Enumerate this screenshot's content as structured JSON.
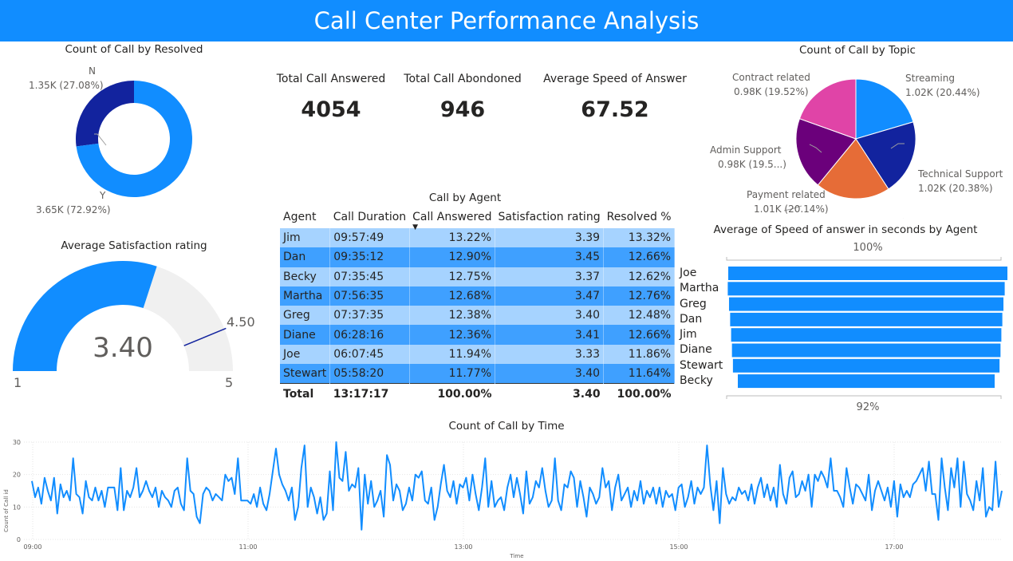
{
  "banner": {
    "title": "Call Center Performance Analysis"
  },
  "colors": {
    "brand": "#118DFF",
    "dark": "#12239E",
    "gauge_bg": "#F0F0F0",
    "pink": "#E044A7",
    "purple": "#6B007B",
    "orange": "#E66C37"
  },
  "resolved": {
    "title": "Count of Call by Resolved",
    "slices": [
      {
        "name": "N",
        "label": "1.35K (27.08%)",
        "value": 27.08
      },
      {
        "name": "Y",
        "label": "3.65K (72.92%)",
        "value": 72.92
      }
    ]
  },
  "kpis": [
    {
      "title": "Total Call Answered",
      "value": "4054"
    },
    {
      "title": "Total Call Abondoned",
      "value": "946"
    },
    {
      "title": "Average Speed of Answer",
      "value": "67.52"
    }
  ],
  "topic": {
    "title": "Count of Call by Topic",
    "slices": [
      {
        "name": "Streaming",
        "label": "1.02K (20.44%)",
        "value": 20.44,
        "color": "#118DFF"
      },
      {
        "name": "Technical Support",
        "label": "1.02K (20.38%)",
        "value": 20.38,
        "color": "#12239E"
      },
      {
        "name": "Payment related",
        "label": "1.01K (20.14%)",
        "value": 20.14,
        "color": "#E66C37"
      },
      {
        "name": "Admin Support",
        "label": "0.98K (19.5...)",
        "value": 19.52,
        "color": "#6B007B"
      },
      {
        "name": "Contract related",
        "label": "0.98K (19.52%)",
        "value": 19.52,
        "color": "#E044A7"
      }
    ]
  },
  "gauge": {
    "title": "Average Satisfaction rating",
    "value": "3.40",
    "min": "1",
    "max": "5",
    "target": "4.50"
  },
  "agents": {
    "title": "Call by Agent",
    "columns": [
      "Agent",
      "Call Duration",
      "Call Answered",
      "Satisfaction rating",
      "Resolved %"
    ],
    "rows": [
      [
        "Jim",
        "09:57:49",
        "13.22%",
        "3.39",
        "13.32%"
      ],
      [
        "Dan",
        "09:35:12",
        "12.90%",
        "3.45",
        "12.66%"
      ],
      [
        "Becky",
        "07:35:45",
        "12.75%",
        "3.37",
        "12.62%"
      ],
      [
        "Martha",
        "07:56:35",
        "12.68%",
        "3.47",
        "12.76%"
      ],
      [
        "Greg",
        "07:37:35",
        "12.38%",
        "3.40",
        "12.48%"
      ],
      [
        "Diane",
        "06:28:16",
        "12.36%",
        "3.41",
        "12.66%"
      ],
      [
        "Joe",
        "06:07:45",
        "11.94%",
        "3.33",
        "11.86%"
      ],
      [
        "Stewart",
        "05:58:20",
        "11.77%",
        "3.40",
        "11.64%"
      ]
    ],
    "total": [
      "Total",
      "13:17:17",
      "100.00%",
      "3.40",
      "100.00%"
    ]
  },
  "speed": {
    "title": "Average of Speed of answer in seconds by Agent",
    "top_label": "100%",
    "bottom_label": "92%",
    "agents": [
      "Joe",
      "Martha",
      "Greg",
      "Dan",
      "Jim",
      "Diane",
      "Stewart",
      "Becky"
    ],
    "values": [
      100,
      99.2,
      98.3,
      97.5,
      96.8,
      96.2,
      95.5,
      92
    ]
  },
  "chart_data": {
    "type": "line",
    "title": "Count of Call by Time",
    "xlabel": "Time",
    "ylabel": "Count of Call id",
    "x_ticks": [
      "09:00",
      "11:00",
      "13:00",
      "15:00",
      "17:00"
    ],
    "y_ticks": [
      0,
      10,
      20,
      30
    ],
    "ylim": [
      0,
      30
    ],
    "grid": true,
    "values": [
      18,
      13,
      16,
      11,
      19,
      15,
      12,
      19,
      8,
      17,
      13,
      15,
      12,
      25,
      14,
      13,
      8,
      18,
      13,
      12,
      16,
      12,
      15,
      10,
      16,
      16,
      16,
      9,
      22,
      9,
      15,
      13,
      16,
      22,
      13,
      15,
      18,
      15,
      13,
      16,
      10,
      15,
      13,
      12,
      10,
      15,
      16,
      11,
      9,
      25,
      15,
      14,
      7,
      5,
      14,
      16,
      15,
      12,
      14,
      13,
      12,
      20,
      18,
      19,
      14,
      25,
      12,
      12,
      12,
      11,
      14,
      10,
      16,
      11,
      9,
      14,
      21,
      28,
      20,
      17,
      15,
      12,
      16,
      6,
      10,
      22,
      29,
      10,
      16,
      13,
      8,
      13,
      6,
      8,
      21,
      9,
      30,
      19,
      18,
      27,
      15,
      17,
      16,
      22,
      3,
      20,
      11,
      18,
      10,
      12,
      15,
      7,
      26,
      23,
      12,
      17,
      15,
      9,
      11,
      16,
      12,
      20,
      19,
      21,
      12,
      11,
      16,
      6,
      10,
      17,
      23,
      15,
      13,
      18,
      11,
      17,
      16,
      19,
      12,
      20,
      14,
      9,
      16,
      25,
      10,
      18,
      10,
      12,
      13,
      9,
      16,
      20,
      13,
      19,
      14,
      8,
      21,
      11,
      13,
      18,
      16,
      22,
      15,
      10,
      12,
      25,
      12,
      9,
      17,
      16,
      21,
      19,
      10,
      18,
      13,
      7,
      16,
      14,
      11,
      13,
      22,
      16,
      18,
      9,
      16,
      20,
      12,
      14,
      16,
      10,
      15,
      12,
      18,
      11,
      15,
      13,
      16,
      11,
      16,
      10,
      15,
      13,
      14,
      9,
      16,
      17,
      10,
      13,
      18,
      11,
      16,
      14,
      16,
      29,
      17,
      9,
      18,
      5,
      22,
      14,
      11,
      13,
      12,
      16,
      14,
      15,
      12,
      17,
      11,
      16,
      19,
      13,
      17,
      12,
      16,
      10,
      23,
      14,
      11,
      19,
      21,
      13,
      14,
      18,
      15,
      20,
      10,
      20,
      18,
      21,
      19,
      16,
      25,
      15,
      15,
      13,
      10,
      22,
      16,
      11,
      17,
      16,
      14,
      12,
      20,
      9,
      15,
      18,
      15,
      12,
      16,
      10,
      18,
      7,
      17,
      13,
      15,
      13,
      17,
      18,
      20,
      22,
      15,
      24,
      14,
      14,
      6,
      25,
      16,
      9,
      22,
      16,
      25,
      10,
      24,
      14,
      12,
      9,
      18,
      12,
      22,
      7,
      10,
      9,
      24,
      10,
      15
    ]
  }
}
